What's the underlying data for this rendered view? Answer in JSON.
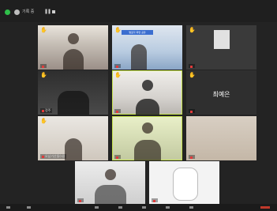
{
  "topbar": {
    "meeting_label": "기록 중",
    "pause_glyph": "❚❚"
  },
  "tiles": [
    {
      "name": "",
      "hand": "✋"
    },
    {
      "name": "",
      "hand": "✋",
      "banner": "발표자 화면 공유"
    },
    {
      "name": "",
      "hand": "✋"
    },
    {
      "name": "정주",
      "hand": "✋"
    },
    {
      "name": "",
      "hand": "✋"
    },
    {
      "name": "",
      "hand": "✋",
      "center": "최예은"
    },
    {
      "name": "오남기산들(네)",
      "hand": "✋"
    },
    {
      "name": "",
      "hand": ""
    },
    {
      "name": "",
      "hand": ""
    },
    {
      "name": "",
      "hand": ""
    },
    {
      "name": "",
      "hand": ""
    }
  ],
  "colors": {
    "active_outline": "#c6e24f",
    "hand": "#f2c21b",
    "muted_mic": "#e03a3a"
  }
}
